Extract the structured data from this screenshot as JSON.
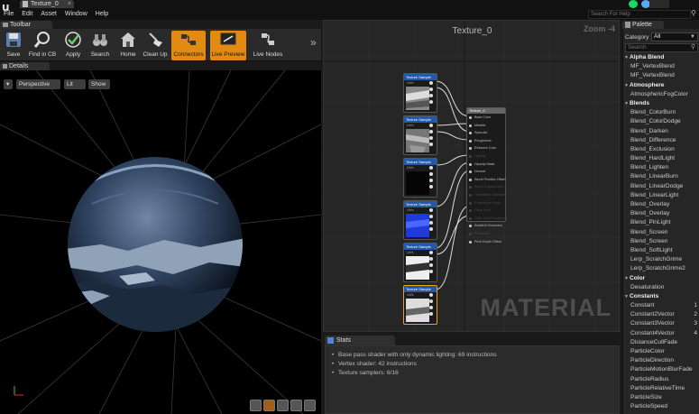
{
  "window": {
    "document_tab": "Texture_0",
    "menu": [
      "File",
      "Edit",
      "Asset",
      "Window",
      "Help"
    ],
    "search_help_placeholder": "Search For Help"
  },
  "toolbar": {
    "tab_label": "Toolbar",
    "buttons": [
      {
        "label": "Save",
        "icon": "save-icon"
      },
      {
        "label": "Find in CB",
        "icon": "find-in-content-browser-icon"
      },
      {
        "label": "Apply",
        "icon": "apply-check-icon"
      },
      {
        "label": "Search",
        "icon": "search-binoculars-icon"
      },
      {
        "label": "Home",
        "icon": "home-icon"
      },
      {
        "label": "Clean Up",
        "icon": "clean-up-broom-icon"
      },
      {
        "label": "Connectors",
        "icon": "connectors-icon",
        "active": true
      },
      {
        "label": "Live Preview",
        "icon": "live-preview-icon",
        "active": true
      },
      {
        "label": "Live Nodes",
        "icon": "live-nodes-icon"
      }
    ]
  },
  "details": {
    "tab_label": "Details",
    "viewport_buttons": {
      "perspective": "Perspective",
      "lit": "Lit",
      "show": "Show"
    }
  },
  "graph": {
    "title": "Texture_0",
    "zoom": "Zoom -4",
    "watermark": "MATERIAL",
    "texture_nodes": [
      {
        "header": "Texture Sample",
        "pin": "UVs",
        "thumb": "gray"
      },
      {
        "header": "Texture Sample",
        "pin": "UVs",
        "thumb": "gray"
      },
      {
        "header": "Texture Sample",
        "pin": "UVs",
        "thumb": "black"
      },
      {
        "header": "Texture Sample",
        "pin": "UVs",
        "thumb": "blue"
      },
      {
        "header": "Texture Sample",
        "pin": "UVs",
        "thumb": "gray"
      },
      {
        "header": "Texture Sample",
        "pin": "UVs",
        "thumb": "gray",
        "selected": true
      }
    ],
    "material_node": {
      "header": "Texture_0",
      "pins": [
        {
          "label": "Base Color",
          "active": true
        },
        {
          "label": "Metallic",
          "active": true
        },
        {
          "label": "Specular",
          "active": true
        },
        {
          "label": "Roughness",
          "active": true
        },
        {
          "label": "Emissive Color",
          "active": true
        },
        {
          "label": "Opacity",
          "active": false
        },
        {
          "label": "Opacity Mask",
          "active": true
        },
        {
          "label": "Normal",
          "active": true
        },
        {
          "label": "World Position Offset",
          "active": true
        },
        {
          "label": "World Displacement",
          "active": false
        },
        {
          "label": "Tessellation Multiplier",
          "active": false
        },
        {
          "label": "Subsurface Color",
          "active": false
        },
        {
          "label": "Clear Coat",
          "active": false
        },
        {
          "label": "Clear Coat Roughness",
          "active": false
        },
        {
          "label": "Ambient Occlusion",
          "active": true
        },
        {
          "label": "Refraction",
          "active": false
        },
        {
          "label": "Pixel Depth Offset",
          "active": true
        }
      ]
    }
  },
  "stats": {
    "tab_label": "Stats",
    "lines": [
      "Base pass shader with only dynamic lighting: 69 instructions",
      "Vertex shader: 42 instructions",
      "Texture samplers: 6/16"
    ]
  },
  "palette": {
    "tab_label": "Palette",
    "category_label": "Category",
    "category_value": "All",
    "search_placeholder": "Search",
    "sections": [
      {
        "title": "Alpha Blend",
        "items": [
          {
            "label": "MF_VertexBlend"
          },
          {
            "label": "MF_VertexBlend"
          }
        ]
      },
      {
        "title": "Atmosphere",
        "items": [
          {
            "label": "AtmosphericFogColor"
          }
        ]
      },
      {
        "title": "Blends",
        "items": [
          {
            "label": "Blend_ColorBurn"
          },
          {
            "label": "Blend_ColorDodge"
          },
          {
            "label": "Blend_Darken"
          },
          {
            "label": "Blend_Difference"
          },
          {
            "label": "Blend_Exclusion"
          },
          {
            "label": "Blend_HardLight"
          },
          {
            "label": "Blend_Lighten"
          },
          {
            "label": "Blend_LinearBurn"
          },
          {
            "label": "Blend_LinearDodge"
          },
          {
            "label": "Blend_LinearLight"
          },
          {
            "label": "Blend_Overlay"
          },
          {
            "label": "Blend_Overlay"
          },
          {
            "label": "Blend_PinLight"
          },
          {
            "label": "Blend_Screen"
          },
          {
            "label": "Blend_Screen"
          },
          {
            "label": "Blend_SoftLight"
          },
          {
            "label": "Lerp_ScratchGrime"
          },
          {
            "label": "Lerp_ScratchGrime2"
          }
        ]
      },
      {
        "title": "Color",
        "items": [
          {
            "label": "Desaturation"
          }
        ]
      },
      {
        "title": "Constants",
        "items": [
          {
            "label": "Constant",
            "hotkey": "1"
          },
          {
            "label": "Constant2Vector",
            "hotkey": "2"
          },
          {
            "label": "Constant3Vector",
            "hotkey": "3"
          },
          {
            "label": "Constant4Vector",
            "hotkey": "4"
          },
          {
            "label": "DistanceCullFade"
          },
          {
            "label": "ParticleColor"
          },
          {
            "label": "ParticleDirection"
          },
          {
            "label": "ParticleMotionBlurFade"
          },
          {
            "label": "ParticleRadius"
          },
          {
            "label": "ParticleRelativeTime"
          },
          {
            "label": "ParticleSize"
          },
          {
            "label": "ParticleSpeed"
          }
        ]
      }
    ]
  }
}
